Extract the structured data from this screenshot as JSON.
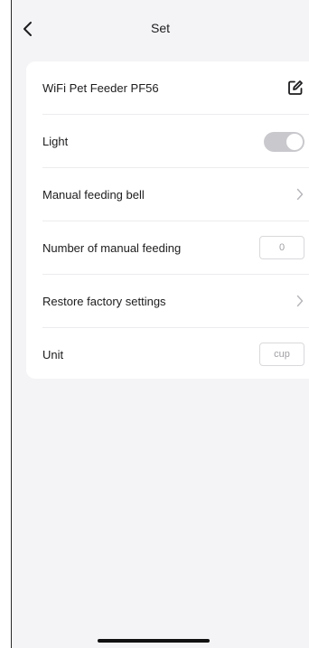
{
  "header": {
    "title": "Set"
  },
  "settings": {
    "device_name": "WiFi Pet Feeder PF56",
    "light_label": "Light",
    "light_on": true,
    "manual_bell_label": "Manual feeding bell",
    "manual_count_label": "Number of manual feeding",
    "manual_count_value": "0",
    "restore_label": "Restore factory settings",
    "unit_label": "Unit",
    "unit_value": "cup"
  },
  "icons": {
    "back": "chevron-left-icon",
    "edit": "edit-icon",
    "chevron": "chevron-right-icon"
  }
}
